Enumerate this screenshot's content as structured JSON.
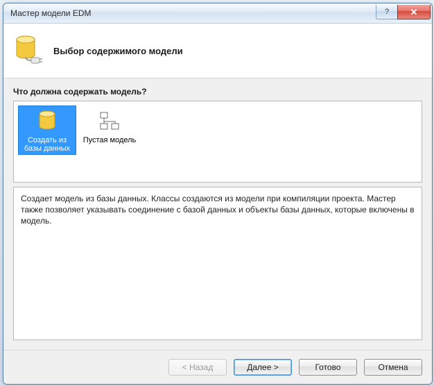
{
  "window": {
    "title": "Мастер модели EDM"
  },
  "header": {
    "heading": "Выбор содержимого модели"
  },
  "content": {
    "prompt": "Что должна содержать модель?",
    "options": [
      {
        "label": "Создать из базы данных",
        "selected": true,
        "icon": "database-icon"
      },
      {
        "label": "Пустая модель",
        "selected": false,
        "icon": "empty-model-icon"
      }
    ],
    "description": "Создает модель из базы данных. Классы создаются из модели при компиляции проекта. Мастер также позволяет указывать соединение с базой данных и объекты базы данных, которые включены в модель."
  },
  "footer": {
    "back": "< Назад",
    "next": "Далее >",
    "finish": "Готово",
    "cancel": "Отмена"
  },
  "titlebar_controls": {
    "help": "?",
    "close": "✕"
  }
}
